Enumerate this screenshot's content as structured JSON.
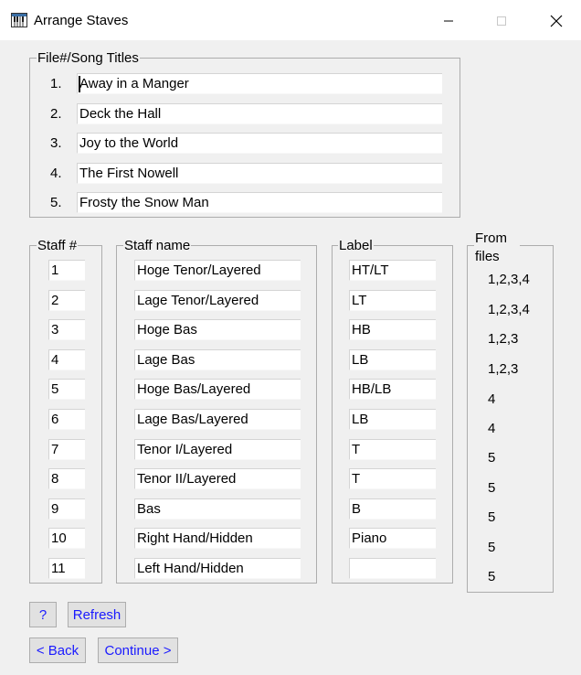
{
  "window": {
    "title": "Arrange Staves",
    "icon": "piano-keys-icon"
  },
  "titles_group": {
    "legend": "File#/Song Titles",
    "items": [
      {
        "num": "1.",
        "title": "Away in a Manger"
      },
      {
        "num": "2.",
        "title": "Deck the Hall"
      },
      {
        "num": "3.",
        "title": "Joy to the World"
      },
      {
        "num": "4.",
        "title": "The First Nowell"
      },
      {
        "num": "5.",
        "title": "Frosty the Snow Man"
      }
    ]
  },
  "staff_table": {
    "staff_legend": "Staff #",
    "name_legend": "Staff name",
    "label_legend": "Label",
    "from_legend": "From files",
    "rows": [
      {
        "staff": "1",
        "name": "Hoge Tenor/Layered",
        "label": "HT/LT",
        "from": "1,2,3,4"
      },
      {
        "staff": "2",
        "name": "Lage Tenor/Layered",
        "label": "LT",
        "from": "1,2,3,4"
      },
      {
        "staff": "3",
        "name": "Hoge Bas",
        "label": "HB",
        "from": "1,2,3"
      },
      {
        "staff": "4",
        "name": "Lage Bas",
        "label": "LB",
        "from": "1,2,3"
      },
      {
        "staff": "5",
        "name": "Hoge Bas/Layered",
        "label": "HB/LB",
        "from": "4"
      },
      {
        "staff": "6",
        "name": "Lage Bas/Layered",
        "label": "LB",
        "from": "4"
      },
      {
        "staff": "7",
        "name": "Tenor I/Layered",
        "label": "T",
        "from": "5"
      },
      {
        "staff": "8",
        "name": "Tenor II/Layered",
        "label": "T",
        "from": "5"
      },
      {
        "staff": "9",
        "name": "Bas",
        "label": "B",
        "from": "5"
      },
      {
        "staff": "10",
        "name": "Right Hand/Hidden",
        "label": "Piano",
        "from": "5"
      },
      {
        "staff": "11",
        "name": "Left Hand/Hidden",
        "label": "",
        "from": "5"
      }
    ]
  },
  "buttons": {
    "help": "?",
    "refresh": "Refresh",
    "back": "< Back",
    "continue": "Continue >"
  }
}
